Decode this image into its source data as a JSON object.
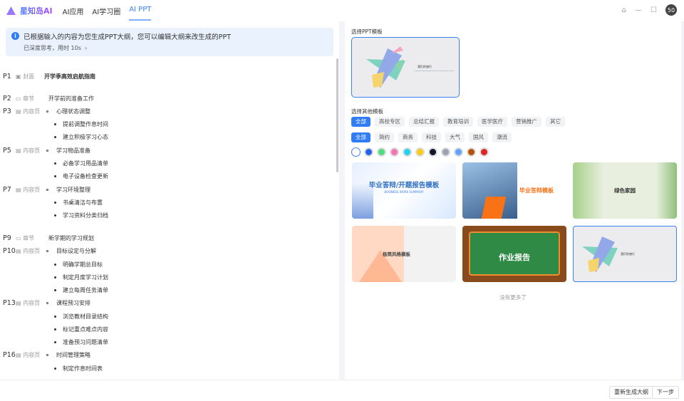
{
  "app": {
    "brand": "星知岛AI",
    "nav": [
      "AI应用",
      "AI学习圈",
      "AI PPT"
    ],
    "active_nav": 2,
    "avatar": "50"
  },
  "notice": {
    "message": "已根据输入的内容为您生成PPT大纲，您可以编辑大纲来改生成的PPT",
    "thinking": "已深度思考，用时 10s",
    "chevron": "›"
  },
  "outline": [
    {
      "page": "P1",
      "type": "封面",
      "text": "开学季高效启航指南",
      "level": 0,
      "icon": "cover-icon"
    },
    {
      "page": "P2",
      "type": "章节",
      "text": "开学前的准备工作",
      "level": 0,
      "icon": "chapter-icon"
    },
    {
      "page": "P3",
      "type": "内容页",
      "text": "心理状态调整",
      "level": 1,
      "icon": "content-page-icon"
    },
    {
      "text": "提前调整作息时间",
      "level": 2
    },
    {
      "text": "建立积极学习心态",
      "level": 2
    },
    {
      "page": "P5",
      "type": "内容页",
      "text": "学习物品准备",
      "level": 1,
      "icon": "content-page-icon"
    },
    {
      "text": "必备学习用品清单",
      "level": 2
    },
    {
      "text": "电子设备检查更新",
      "level": 2
    },
    {
      "page": "P7",
      "type": "内容页",
      "text": "学习环境整理",
      "level": 1,
      "icon": "content-page-icon"
    },
    {
      "text": "书桌清洁与布置",
      "level": 2
    },
    {
      "text": "学习资料分类归档",
      "level": 2
    },
    {
      "page": "P9",
      "type": "章节",
      "text": "新学期的学习规划",
      "level": 0,
      "icon": "chapter-icon"
    },
    {
      "page": "P10",
      "type": "内容页",
      "text": "目标设定与分解",
      "level": 1,
      "icon": "content-page-icon"
    },
    {
      "text": "明确学期总目标",
      "level": 2
    },
    {
      "text": "制定月度学习计划",
      "level": 2
    },
    {
      "text": "建立每周任务清单",
      "level": 2
    },
    {
      "page": "P13",
      "type": "内容页",
      "text": "课程预习安排",
      "level": 1,
      "icon": "content-page-icon"
    },
    {
      "text": "浏览教材目录结构",
      "level": 2
    },
    {
      "text": "标记重点难点内容",
      "level": 2
    },
    {
      "text": "准备预习问题清单",
      "level": 2
    },
    {
      "page": "P16",
      "type": "内容页",
      "text": "时间管理策略",
      "level": 1,
      "icon": "content-page-icon"
    },
    {
      "text": "制定作息时间表",
      "level": 2
    }
  ],
  "templates": {
    "selected_label": "选择PPT模板",
    "other_label": "选择其他模板",
    "categories": [
      "全部",
      "高校专区",
      "总结汇报",
      "教育培训",
      "医学医疗",
      "营销推广",
      "其它"
    ],
    "styles": [
      "全部",
      "简约",
      "商务",
      "科技",
      "大气",
      "国风",
      "潮流"
    ],
    "colors": [
      "#ffffff",
      "#2563eb",
      "#4ade80",
      "#f472b6",
      "#22d3ee",
      "#facc15",
      "#111827",
      "#9ca3af",
      "#60a5fa",
      "#b45309",
      "#dc2626"
    ],
    "items": [
      {
        "title": "毕业答辩/开题报告模板",
        "subtitle": "BUSINESS WORK SUMMARY"
      },
      {
        "title": "毕业答辩模板"
      },
      {
        "title": "绿色家园"
      },
      {
        "title": "极简风格模板"
      },
      {
        "title": "作业报告"
      },
      {
        "title": "我们的旅行"
      }
    ],
    "no_more": "没有更多了"
  },
  "footer": {
    "regenerate": "重新生成大纲",
    "next": "下一步"
  }
}
